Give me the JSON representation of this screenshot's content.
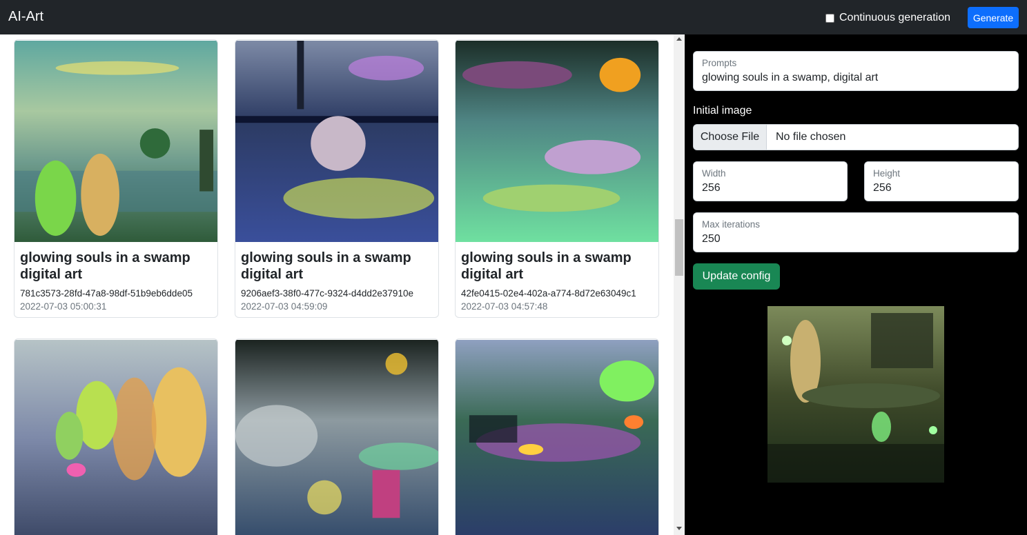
{
  "navbar": {
    "brand": "AI-Art",
    "continuous_label": "Continuous generation",
    "continuous_checked": false,
    "generate_label": "Generate"
  },
  "gallery": {
    "cards": [
      {
        "title": "glowing souls in a swamp digital art",
        "uuid": "781c3573-28fd-47a8-98df-51b9eb6dde05",
        "date": "2022-07-03 05:00:31"
      },
      {
        "title": "glowing souls in a swamp digital art",
        "uuid": "9206aef3-38f0-477c-9324-d4dd2e37910e",
        "date": "2022-07-03 04:59:09"
      },
      {
        "title": "glowing souls in a swamp digital art",
        "uuid": "42fe0415-02e4-402a-a774-8d72e63049c1",
        "date": "2022-07-03 04:57:48"
      },
      {
        "title": "",
        "uuid": "",
        "date": ""
      },
      {
        "title": "",
        "uuid": "",
        "date": ""
      },
      {
        "title": "",
        "uuid": "",
        "date": ""
      }
    ]
  },
  "config": {
    "prompts_label": "Prompts",
    "prompts_value": "glowing souls in a swamp, digital art",
    "initial_image_label": "Initial image",
    "choose_file_label": "Choose File",
    "no_file_label": "No file chosen",
    "width_label": "Width",
    "width_value": "256",
    "height_label": "Height",
    "height_value": "256",
    "max_iter_label": "Max iterations",
    "max_iter_value": "250",
    "update_label": "Update config"
  },
  "colors": {
    "navbar_bg": "#212529",
    "primary": "#0d6efd",
    "success": "#198754",
    "panel_bg": "#000000"
  }
}
